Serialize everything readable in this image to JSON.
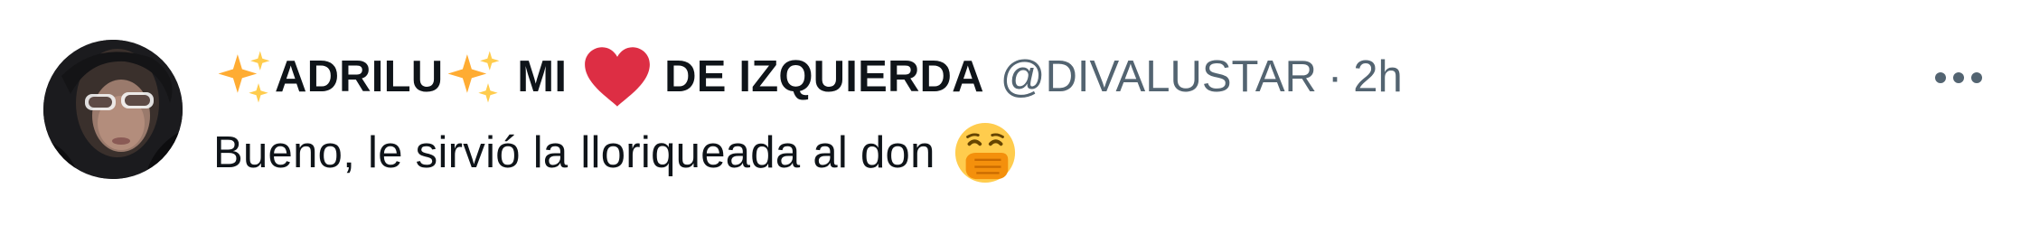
{
  "tweet": {
    "author": {
      "name_part1": "ADRILU",
      "name_part2": "MI",
      "name_part3": "DE IZQUIERDA",
      "name_icons": [
        "sparkles-icon",
        "sparkles-icon",
        "red-heart-icon"
      ],
      "handle": "@DIVALUSTAR",
      "avatar": "avatar-photo"
    },
    "separator": "·",
    "timestamp": "2h",
    "text": "Bueno, le sirvió la lloriqueada al don",
    "text_icon": "face-with-hand-over-mouth-icon",
    "more_icon": "more-options-icon"
  },
  "colors": {
    "primary_text": "#0f1419",
    "secondary_text": "#536471",
    "heart": "#dd2e44",
    "sparkle": "#ffac33",
    "face": "#ffcc4d"
  }
}
